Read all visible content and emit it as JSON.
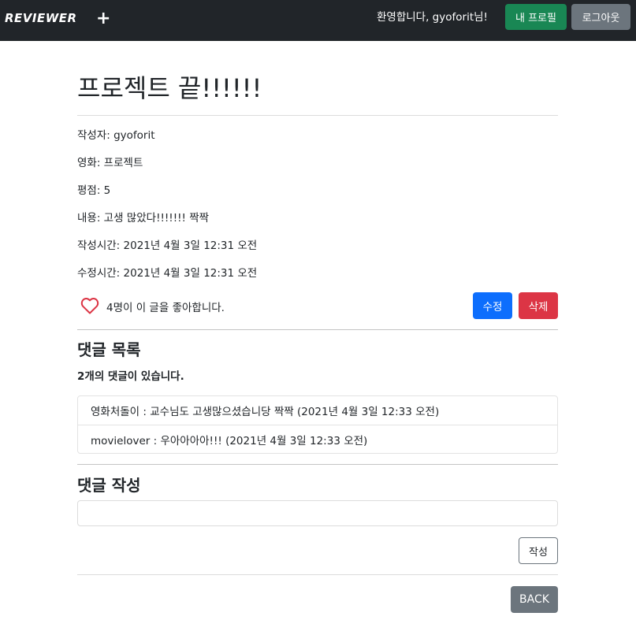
{
  "navbar": {
    "brand": "REVIEWER",
    "add_label": "+",
    "welcome": "환영합니다, gyoforit님!",
    "profile_label": "내 프로필",
    "logout_label": "로그아웃"
  },
  "review": {
    "title": "프로젝트 끝!!!!!!",
    "author": "작성자: gyoforit",
    "movie": "영화: 프로젝트",
    "rating": "평점: 5",
    "content": "내용: 고생 많았다!!!!!!! 짝짝",
    "created": "작성시간: 2021년 4월 3일 12:31 오전",
    "updated": "수정시간: 2021년 4월 3일 12:31 오전",
    "likes_text": "4명이 이 글을 좋아합니다.",
    "edit_label": "수정",
    "delete_label": "삭제"
  },
  "comments": {
    "heading": "댓글 목록",
    "count_text": "2개의 댓글이 있습니다.",
    "items": [
      {
        "text": "영화처돌이 : 교수님도 고생많으셨습니당 짝짝 (2021년 4월 3일 12:33 오전)"
      },
      {
        "text": "movielover : 우아아아아!!! (2021년 4월 3일 12:33 오전)"
      }
    ]
  },
  "comment_form": {
    "heading": "댓글 작성",
    "value": "",
    "submit_label": "작성"
  },
  "back_label": "BACK",
  "colors": {
    "navbar": "#212529",
    "profile_button": "#198754",
    "logout_button": "#6c757d",
    "edit_button": "#0d6efd",
    "delete_button": "#dc3545",
    "heart": "#dc3545"
  },
  "icons": {
    "heart": "heart-outline-icon"
  }
}
